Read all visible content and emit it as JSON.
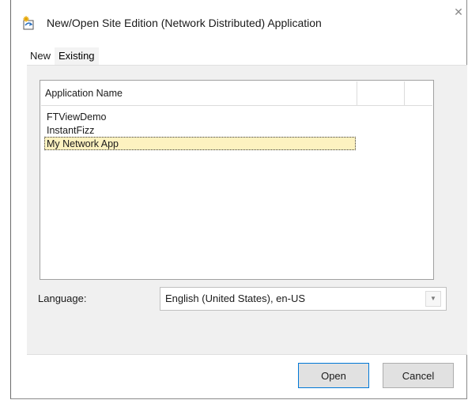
{
  "window": {
    "title": "New/Open Site Edition (Network Distributed) Application",
    "close_glyph": "✕"
  },
  "tabs": [
    {
      "label": "New",
      "active": false
    },
    {
      "label": "Existing",
      "active": true
    }
  ],
  "application_list": {
    "columns": [
      "Application Name",
      ""
    ],
    "rows": [
      "FTViewDemo",
      "InstantFizz",
      "My Network App"
    ],
    "selected_row": "My Network App"
  },
  "language": {
    "label": "Language:",
    "value": "English (United States), en-US"
  },
  "buttons": {
    "open": "Open",
    "cancel": "Cancel"
  },
  "colors": {
    "selected_row_bg": "#fdf2c0",
    "panel_bg": "#f0f0f0",
    "default_button_border": "#0078d7"
  }
}
